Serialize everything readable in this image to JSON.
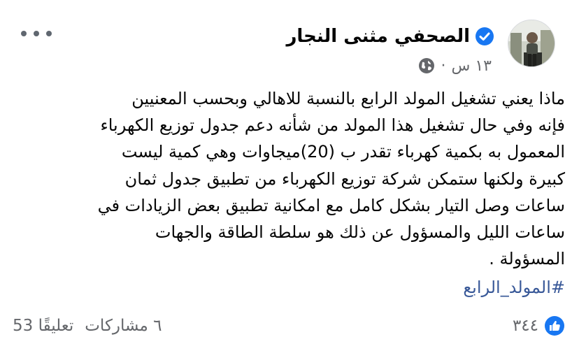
{
  "post": {
    "author": "الصحفي مثنى النجار",
    "time": "١٣ س",
    "separator": "·",
    "lines": [
      "ماذا يعني تشغيل المولد الرابع بالنسبة للاهالي وبحسب المعنيين",
      "فإنه وفي حال تشغيل هذا المولد من شأنه دعم جدول توزيع الكهرباء",
      "المعمول به بكمية كهرباء تقدر ب (20)ميجاوات وهي كمية ليست",
      "كبيرة ولكنها ستمكن شركة توزيع الكهرباء من تطبيق جدول ثمان",
      "ساعات وصل التيار بشكل كامل مع امكانية تطبيق بعض الزيادات في",
      "ساعات الليل والمسؤول عن ذلك هو سلطة الطاقة والجهات",
      "المسؤولة ."
    ],
    "hashtag": "#المولد_الرابع"
  },
  "footer": {
    "reactions_count": "٣٤٤",
    "shares": "٦ مشاركات",
    "comments": "53 تعليقًا"
  },
  "colors": {
    "text": "#050505",
    "muted": "#65676b",
    "link": "#385898",
    "verified": "#1877f2",
    "like": "#1877f2"
  },
  "icons": [
    "avatar",
    "verified-badge-icon",
    "globe-icon",
    "more-options-icon",
    "like-reaction-icon"
  ]
}
